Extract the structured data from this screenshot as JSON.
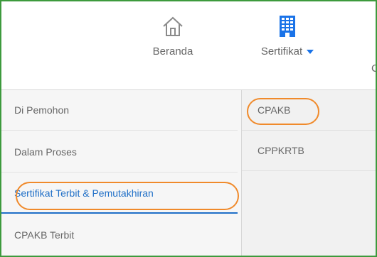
{
  "nav": {
    "items": [
      {
        "label": "Beranda",
        "icon": "home-icon"
      },
      {
        "label": "Sertifikat",
        "icon": "building-icon",
        "has_dropdown": true
      }
    ],
    "partial_next_label": "C",
    "accent_color": "#1a73e8"
  },
  "dropdown": {
    "items": [
      {
        "label": "Di Pemohon"
      },
      {
        "label": "Dalam Proses"
      },
      {
        "label": "Sertifikat Terbit & Pemutakhiran",
        "active": true
      },
      {
        "label": "CPAKB Terbit"
      }
    ]
  },
  "submenu": {
    "items": [
      {
        "label": "CPAKB"
      },
      {
        "label": "CPPKRTB"
      }
    ]
  },
  "annotation": {
    "highlight_color": "#f08a2b"
  }
}
